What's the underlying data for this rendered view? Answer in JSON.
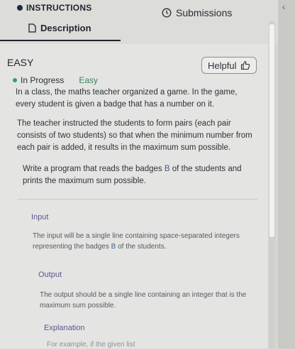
{
  "header": {
    "instructions_label": "INSTRUCTIONS",
    "tabs": [
      {
        "label": "Description",
        "active": true
      },
      {
        "label": "Submissions",
        "active": false
      }
    ]
  },
  "problem": {
    "difficulty": "EASY",
    "helpful_label": "Helpful",
    "status": "In Progress",
    "level": "Easy",
    "intro": "In a class, the maths teacher organized a game. In the game, every student is given a badge that has a number on it.",
    "task": "The teacher instructed the students to form pairs (each pair consists of two students) so that when the minimum number from each pair is added, it results in the maximum sum possible.",
    "program_before": "Write a program that reads the badges ",
    "program_var": "B",
    "program_after": " of the students and prints the maximum sum possible.",
    "input_title": "Input",
    "input_before": "The input will be a single line containing space-separated integers representing the badges ",
    "input_var": "B",
    "input_after": " of the students.",
    "output_title": "Output",
    "output_text": "The output should be a single line containing an integer that is the maximum sum possible.",
    "explanation_title": "Explanation",
    "explanation_text": "For example, if the given list"
  },
  "colors": {
    "accent": "#5d5590",
    "status": "#3d9a6a",
    "dark": "#1c2b4a"
  }
}
